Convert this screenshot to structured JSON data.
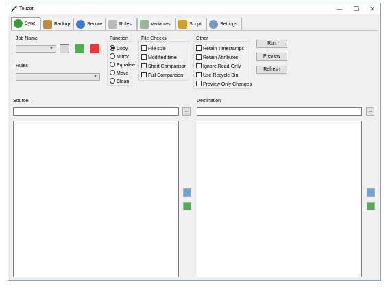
{
  "window": {
    "title": "Toucan",
    "minimize": "—",
    "maximize": "☐",
    "close": "✕"
  },
  "tabs": [
    {
      "label": "Sync",
      "icon": "sync-icon",
      "color": "#3a9a3a"
    },
    {
      "label": "Backup",
      "icon": "backup-icon",
      "color": "#c08a3e"
    },
    {
      "label": "Secure",
      "icon": "secure-icon",
      "color": "#3a7bd5"
    },
    {
      "label": "Rules",
      "icon": "rules-icon",
      "color": "#888888"
    },
    {
      "label": "Variables",
      "icon": "variables-icon",
      "color": "#6a8a6a"
    },
    {
      "label": "Script",
      "icon": "script-icon",
      "color": "#d4a02a"
    },
    {
      "label": "Settings",
      "icon": "settings-icon",
      "color": "#7a9ac0"
    }
  ],
  "job": {
    "label": "Job Name",
    "value": "",
    "save_icon": "save-icon",
    "add_icon": "add-icon",
    "remove_icon": "remove-icon"
  },
  "rules": {
    "label": "Rules",
    "value": ""
  },
  "function": {
    "label": "Function",
    "options": [
      "Copy",
      "Mirror",
      "Equalise",
      "Move",
      "Clean"
    ],
    "selected": "Copy"
  },
  "file_checks": {
    "label": "File Checks",
    "options": [
      "File size",
      "Modified time",
      "Short Comparison",
      "Full Comparison"
    ]
  },
  "other": {
    "label": "Other",
    "options": [
      "Retain Timestamps",
      "Retain Attributes",
      "Ignore Read-Only",
      "Use Recycle Bin",
      "Preview Only Changes"
    ]
  },
  "actions": {
    "run": "Run",
    "preview": "Preview",
    "refresh": "Refresh"
  },
  "source": {
    "label": "Source",
    "value": "",
    "browse": "..."
  },
  "destination": {
    "label": "Destination",
    "value": "",
    "browse": "..."
  }
}
